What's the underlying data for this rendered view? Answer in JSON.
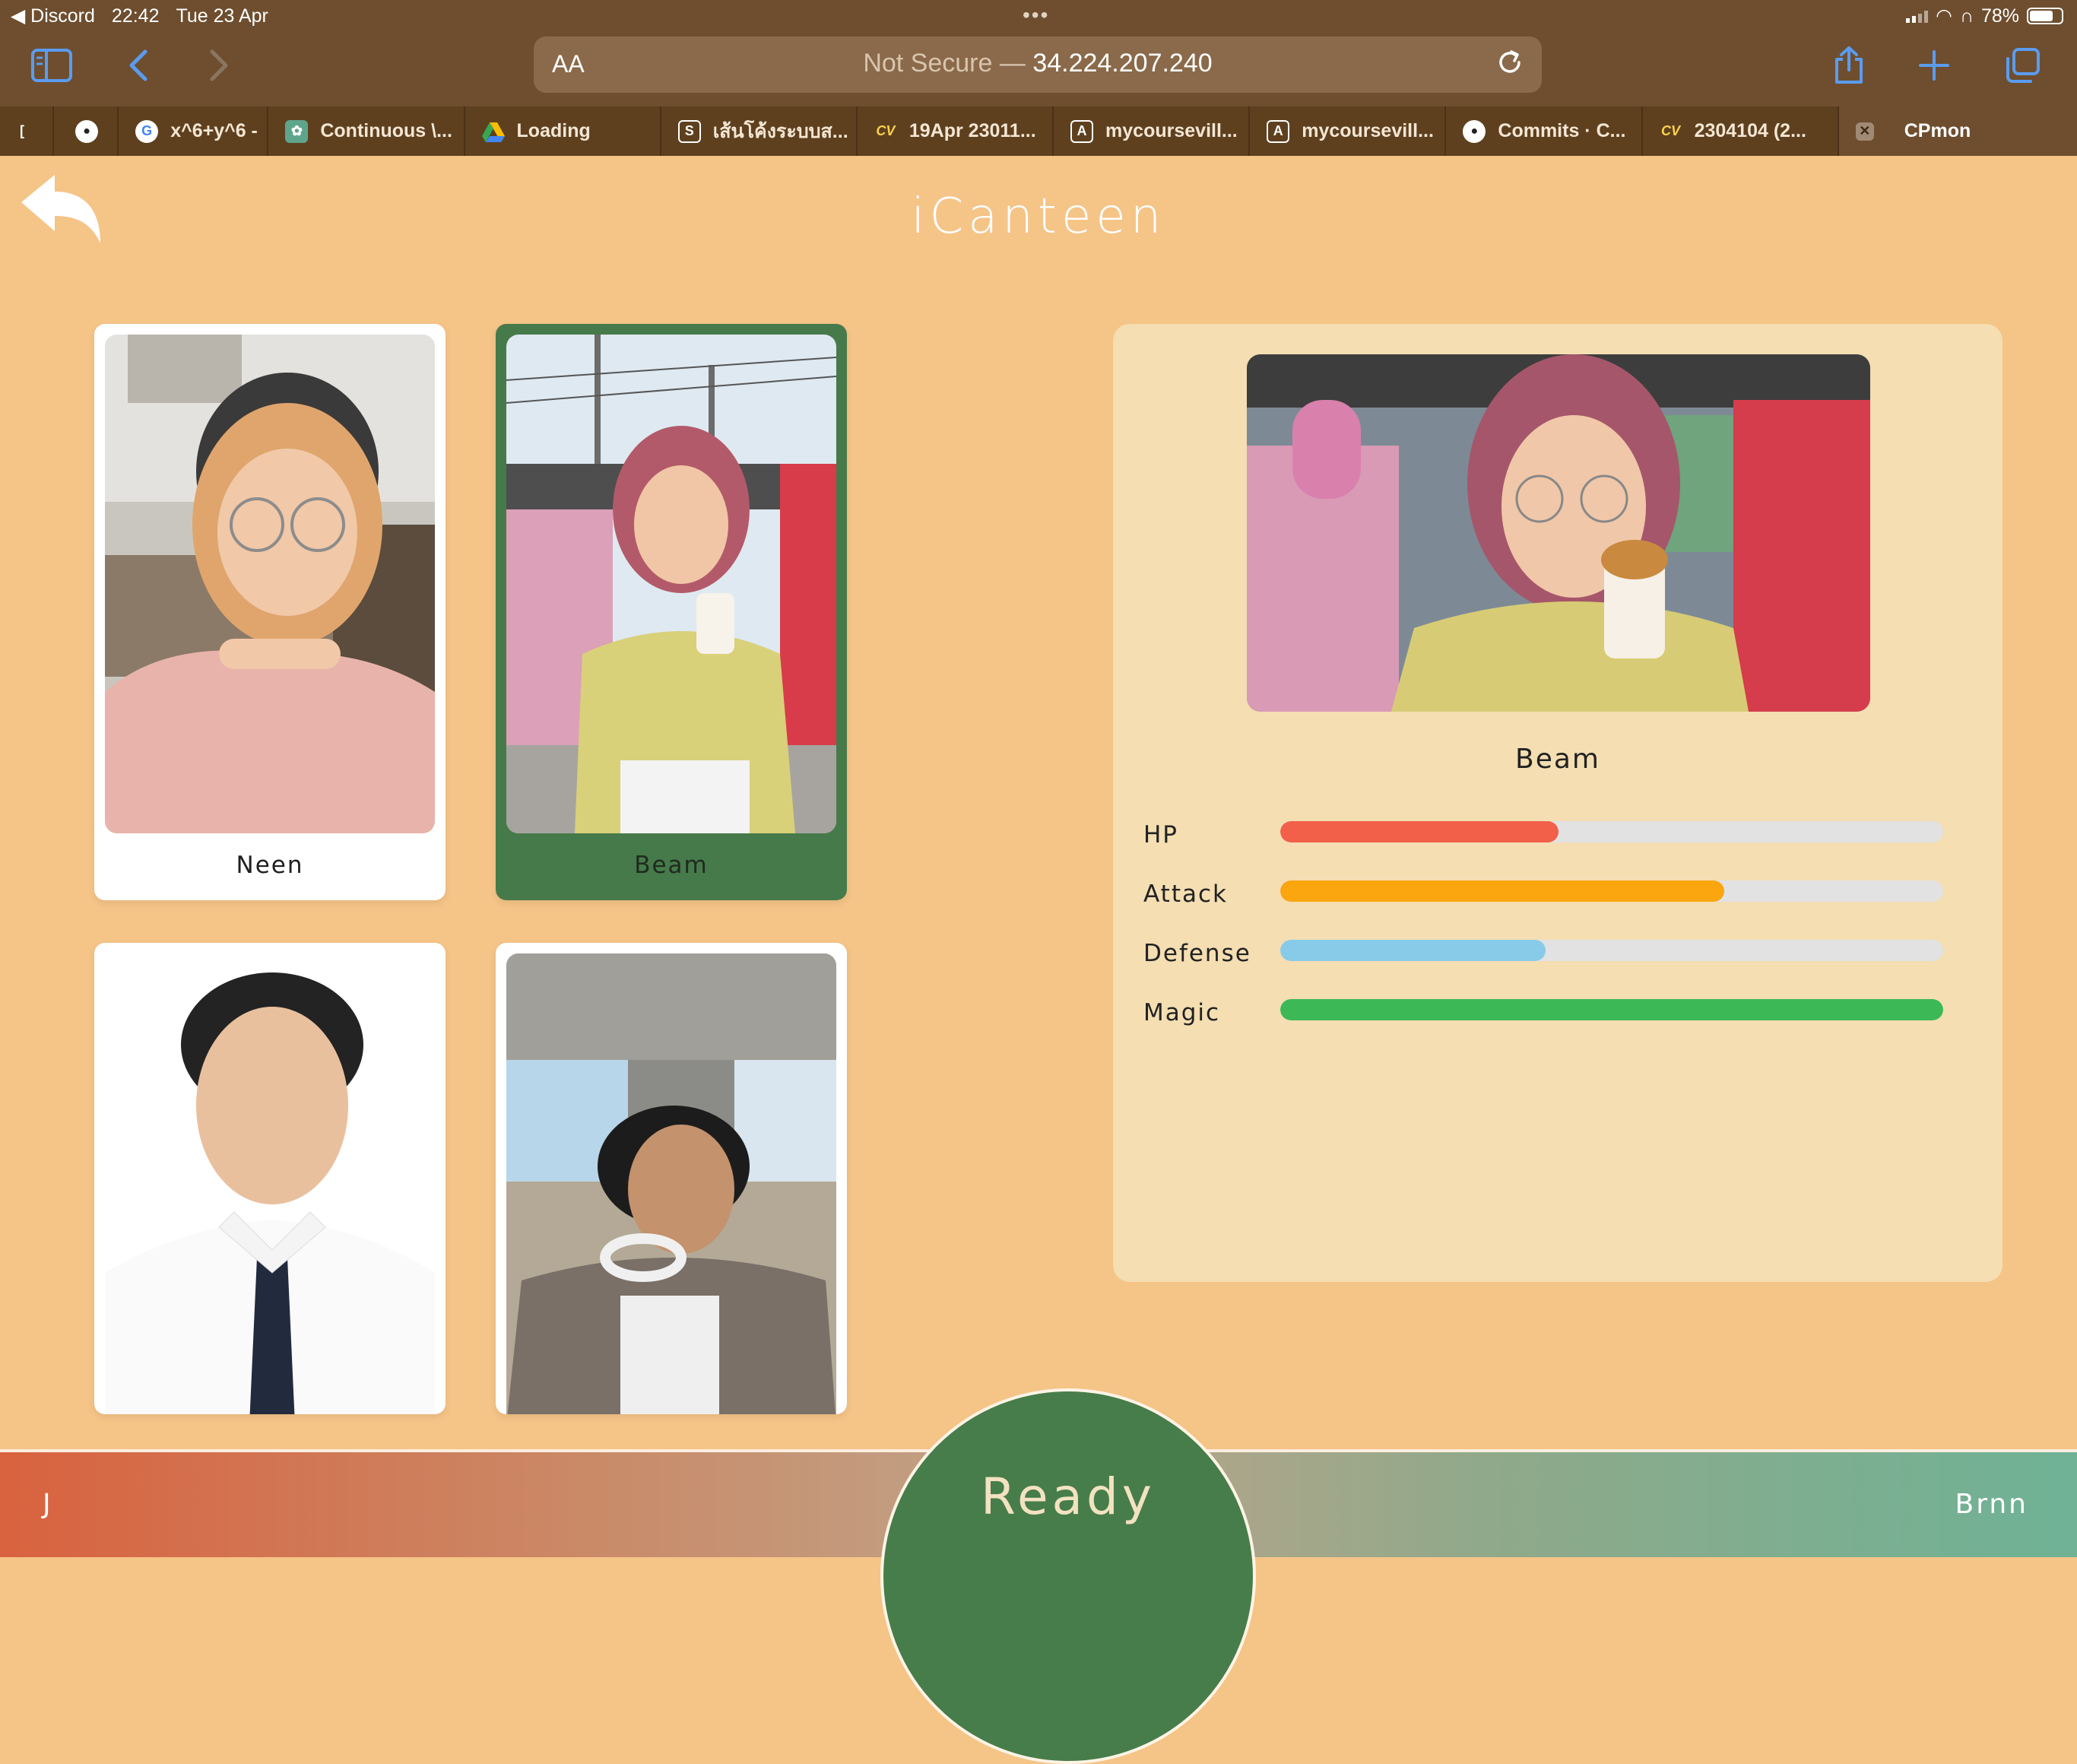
{
  "status_bar": {
    "back_app": "Discord",
    "time": "22:42",
    "date": "Tue 23 Apr",
    "battery": "78%",
    "battery_level": 0.78
  },
  "browser": {
    "aa_label": "AA",
    "url_prefix": "Not Secure — ",
    "url_host": "34.224.207.240",
    "tabs": [
      {
        "label": "x^6+y^6 -",
        "icon": "google-icon"
      },
      {
        "label": "Continuous \\...",
        "icon": "chatgpt-icon"
      },
      {
        "label": "Loading",
        "icon": "google-drive-icon"
      },
      {
        "label": "เส้นโค้งระบบส...",
        "icon": "s-icon"
      },
      {
        "label": "19Apr 23011...",
        "icon": "cv-icon"
      },
      {
        "label": "mycoursevill...",
        "icon": "a-icon"
      },
      {
        "label": "mycoursevill...",
        "icon": "a-icon"
      },
      {
        "label": "Commits · C...",
        "icon": "github-icon"
      },
      {
        "label": "2304104 (2...",
        "icon": "cv-icon"
      },
      {
        "label": "CPmon",
        "icon": "close-tab-icon",
        "active": true
      }
    ]
  },
  "app": {
    "title": "iCanteen",
    "characters": [
      {
        "name": "Neen",
        "selected": false
      },
      {
        "name": "Beam",
        "selected": true
      },
      {
        "name": "",
        "selected": false
      },
      {
        "name": "",
        "selected": false
      }
    ],
    "detail": {
      "name": "Beam",
      "stats": [
        {
          "label": "HP",
          "value": 0.42,
          "color": "#f2604a"
        },
        {
          "label": "Attack",
          "value": 0.67,
          "color": "#fba50f"
        },
        {
          "label": "Defense",
          "value": 0.4,
          "color": "#87cbe9"
        },
        {
          "label": "Magic",
          "value": 1.0,
          "color": "#3cb956"
        }
      ]
    },
    "bottom": {
      "player_left": "J",
      "player_right": "Brnn",
      "ready_label": "Ready"
    }
  }
}
